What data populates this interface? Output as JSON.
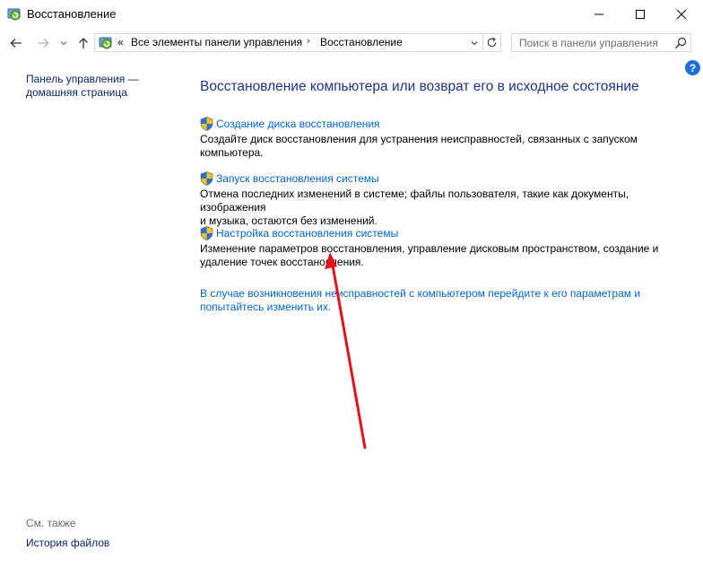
{
  "window": {
    "title": "Восстановление"
  },
  "address_bar": {
    "overflow": "«",
    "crumbs": [
      "Все элементы панели управления",
      "Восстановление"
    ]
  },
  "search": {
    "placeholder": "Поиск в панели управления"
  },
  "help": {
    "label": "?"
  },
  "sidebar": {
    "home_line1": "Панель управления —",
    "home_line2": "домашняя страница",
    "see_also": "См. также",
    "file_history": "История файлов"
  },
  "main": {
    "heading": "Восстановление компьютера или возврат его в исходное состояние",
    "tasks": [
      {
        "link": "Создание диска восстановления",
        "desc_line1": "Создайте диск восстановления для устранения неисправностей, связанных с запуском",
        "desc_line2": "компьютера."
      },
      {
        "link": "Запуск восстановления системы",
        "desc_line1": "Отмена последних изменений в системе; файлы пользователя, такие как документы, изображения",
        "desc_line2": "и музыка, остаются без изменений."
      },
      {
        "link": "Настройка восстановления системы",
        "desc_line1": "Изменение параметров восстановления, управление дисковым пространством, создание и",
        "desc_line2": "удаление точек восстановления."
      }
    ],
    "bottom_link_line1": "В случае возникновения неисправностей с компьютером перейдите к его параметрам и",
    "bottom_link_line2": "попытайтесь изменить их."
  },
  "colors": {
    "heading": "#1e3287",
    "link": "#0066cc",
    "annotation_arrow": "#e8101a"
  },
  "icons": {
    "window": "recovery-icon",
    "task": "uac-shield-icon",
    "back": "arrow-left-icon",
    "forward": "arrow-right-icon",
    "up": "arrow-up-icon",
    "refresh": "refresh-icon",
    "search": "search-icon"
  }
}
